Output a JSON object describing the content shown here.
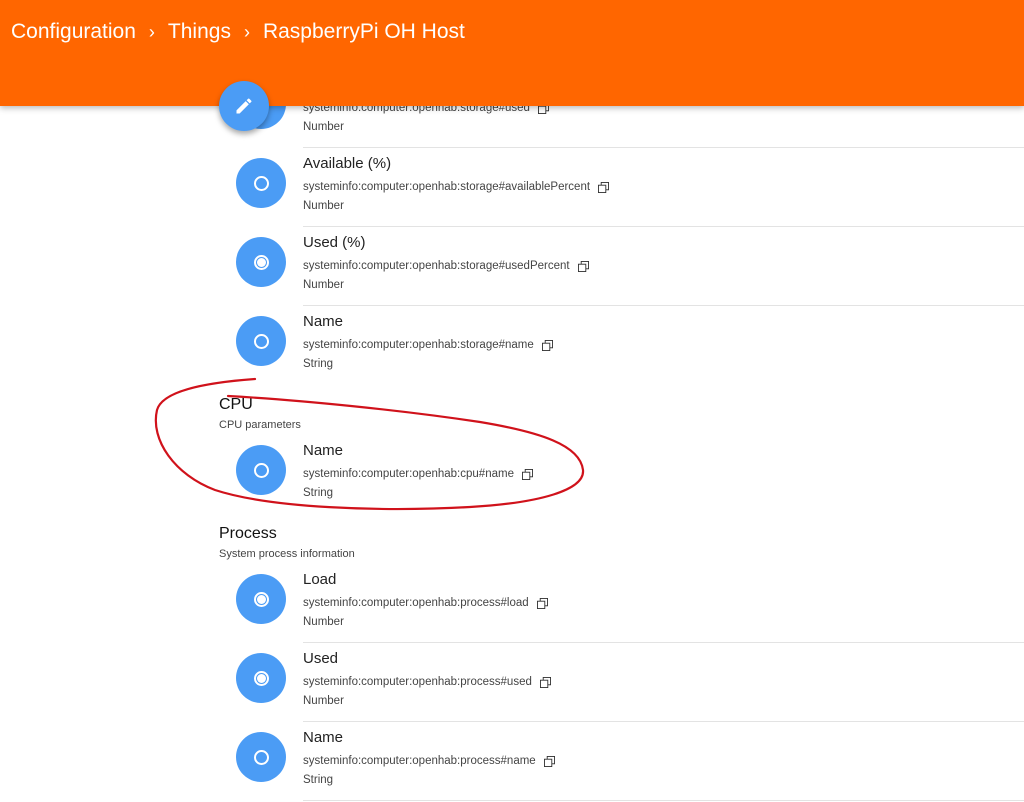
{
  "header": {
    "breadcrumb": [
      {
        "label": "Configuration"
      },
      {
        "label": "Things"
      },
      {
        "label": "RaspberryPi OH Host"
      }
    ],
    "separator": "›",
    "background_color": "#ff6600"
  },
  "fab": {
    "icon": "pencil-icon"
  },
  "storage_rows": [
    {
      "title": "",
      "uid": "systeminfo:computer:openhab:storage#used",
      "type": "Number",
      "linked": false
    },
    {
      "title": "Available (%)",
      "uid": "systeminfo:computer:openhab:storage#availablePercent",
      "type": "Number",
      "linked": false
    },
    {
      "title": "Used (%)",
      "uid": "systeminfo:computer:openhab:storage#usedPercent",
      "type": "Number",
      "linked": true
    },
    {
      "title": "Name",
      "uid": "systeminfo:computer:openhab:storage#name",
      "type": "String",
      "linked": false
    }
  ],
  "cpu_group": {
    "title": "CPU",
    "description": "CPU parameters",
    "rows": [
      {
        "title": "Name",
        "uid": "systeminfo:computer:openhab:cpu#name",
        "type": "String",
        "linked": false
      }
    ]
  },
  "process_group": {
    "title": "Process",
    "description": "System process information",
    "rows": [
      {
        "title": "Load",
        "uid": "systeminfo:computer:openhab:process#load",
        "type": "Number",
        "linked": true
      },
      {
        "title": "Used",
        "uid": "systeminfo:computer:openhab:process#used",
        "type": "Number",
        "linked": true
      },
      {
        "title": "Name",
        "uid": "systeminfo:computer:openhab:process#name",
        "type": "String",
        "linked": false
      }
    ]
  },
  "colors": {
    "accent": "#4b9cf5",
    "annotation": "#d0121b"
  }
}
